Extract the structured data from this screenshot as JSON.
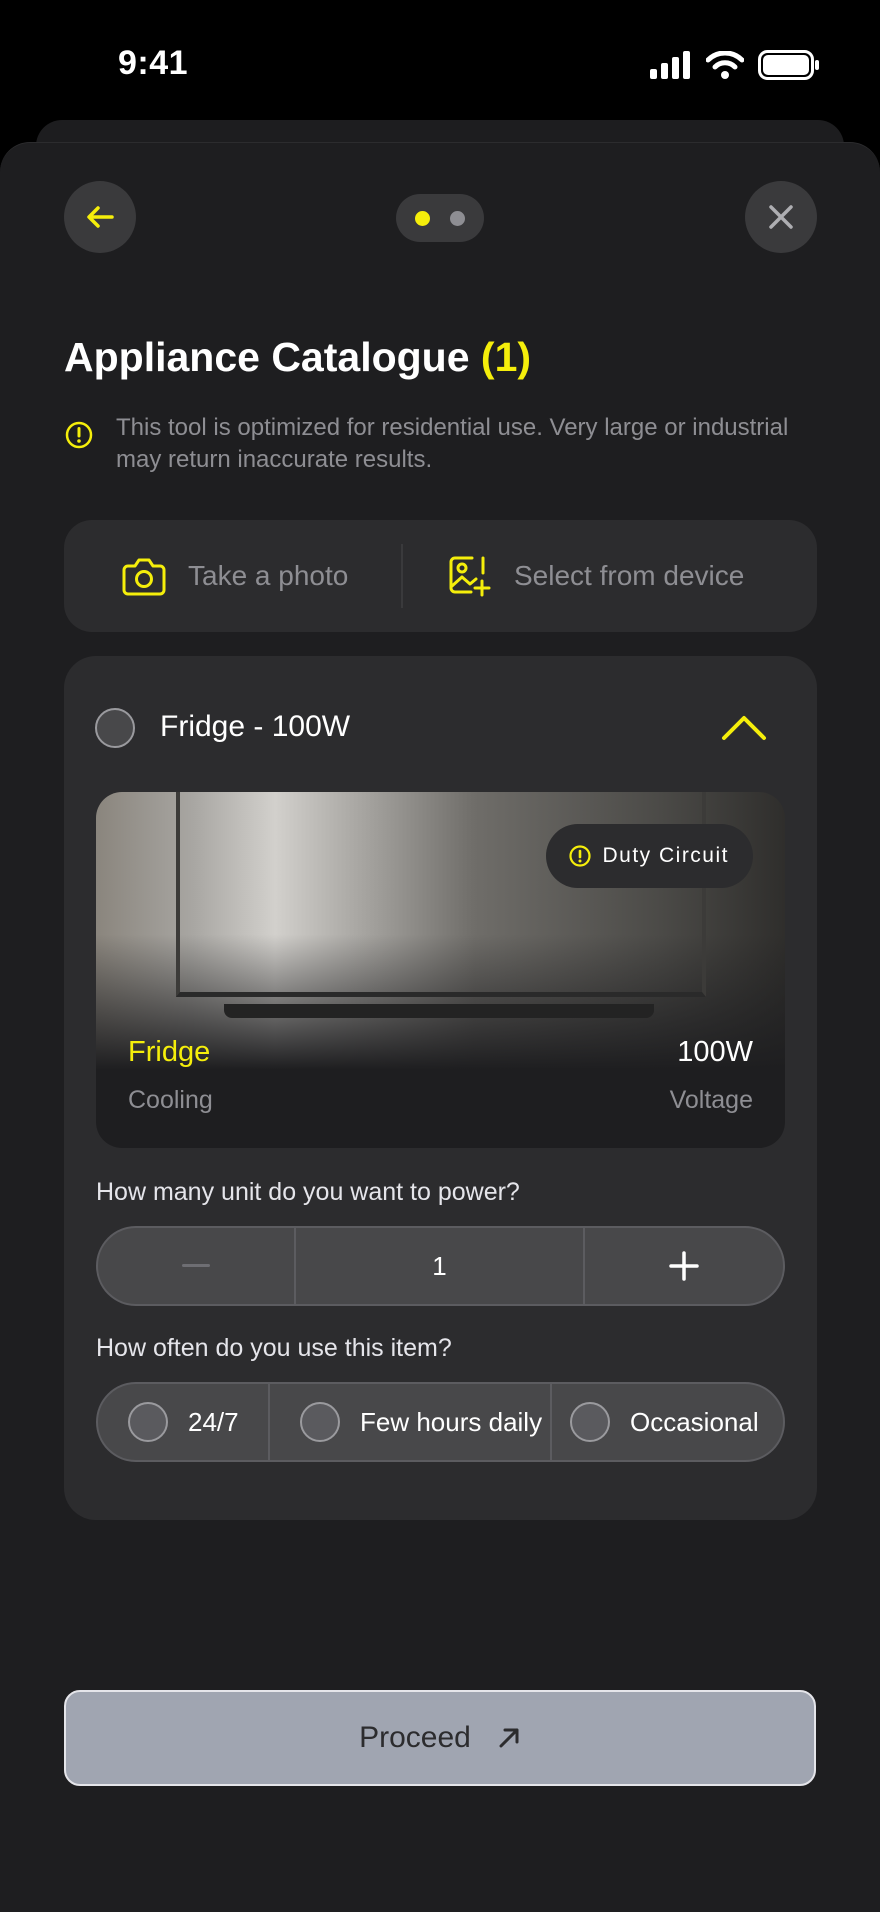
{
  "status_bar": {
    "time": "9:41"
  },
  "header": {
    "pager": {
      "total": 2,
      "active": 1
    }
  },
  "page": {
    "title": "Appliance Catalogue",
    "count": "(1)",
    "notice": "This tool is optimized for residential use. Very large or industrial may return inaccurate results."
  },
  "upload": {
    "take_photo": "Take a photo",
    "select_device": "Select from device"
  },
  "item": {
    "header_label": "Fridge - 100W",
    "expanded": true,
    "badge": "Duty Circuit",
    "name": "Fridge",
    "power": "100W",
    "category": "Cooling",
    "power_label": "Voltage",
    "quantity_question": "How many unit do you want to power?",
    "quantity": "1",
    "usage_question": "How often do you use this item?",
    "usage_options": [
      "24/7",
      "Few hours daily",
      "Occasional"
    ]
  },
  "footer": {
    "proceed_label": "Proceed"
  },
  "colors": {
    "accent": "#f5ee0b",
    "card": "#2c2c2e",
    "sheet": "#1e1e20",
    "button": "#a0a5b1"
  }
}
